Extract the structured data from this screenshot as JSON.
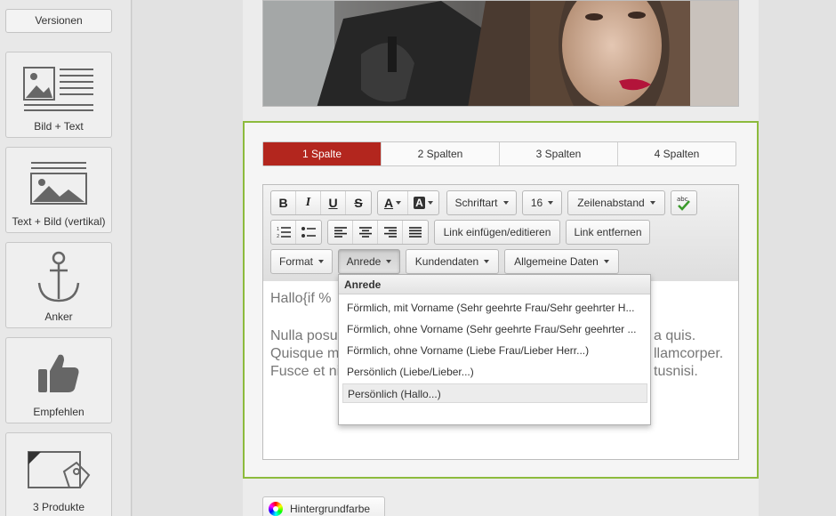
{
  "sidebar": {
    "versions_label": "Versionen",
    "tiles": [
      {
        "label": "Bild + Text",
        "icon": "image-text-icon"
      },
      {
        "label": "Text + Bild (vertikal)",
        "icon": "text-image-vertical-icon"
      },
      {
        "label": "Anker",
        "icon": "anchor-icon"
      },
      {
        "label": "Empfehlen",
        "icon": "thumbs-up-icon"
      },
      {
        "label": "3 Produkte",
        "icon": "products-tag-icon"
      }
    ]
  },
  "tabs": [
    {
      "label": "1 Spalte",
      "active": true
    },
    {
      "label": "2 Spalten",
      "active": false
    },
    {
      "label": "3 Spalten",
      "active": false
    },
    {
      "label": "4 Spalten",
      "active": false
    }
  ],
  "toolbar": {
    "font_label": "Schriftart",
    "size_label": "16",
    "line_height_label": "Zeilenabstand",
    "insert_link_label": "Link einfügen/editieren",
    "remove_link_label": "Link entfernen",
    "format_label": "Format",
    "salutation_label": "Anrede",
    "customer_data_label": "Kundendaten",
    "general_data_label": "Allgemeine Daten"
  },
  "editor": {
    "line1": "Hallo{if %",
    "line2": "Nulla posuc",
    "line3": "Quisque m",
    "line4": "Fusce et ni",
    "line2_tail": "a quis.",
    "line3_tail": "llamcorper.",
    "line4_tail": "tusnisi."
  },
  "dropdown": {
    "header": "Anrede",
    "items": [
      "Förmlich, mit Vorname (Sehr geehrte Frau/Sehr geehrter H...",
      "Förmlich, ohne Vorname (Sehr geehrte Frau/Sehr geehrter ...",
      "Förmlich, ohne Vorname (Liebe Frau/Lieber Herr...)",
      "Persönlich (Liebe/Lieber...)",
      "Persönlich (Hallo...)"
    ],
    "hovered_index": 4
  },
  "background_button_label": "Hintergrundfarbe",
  "colors": {
    "active_tab": "#b3261e",
    "block_border": "#8dbb3d",
    "spellcheck_mark": "#3a9a2a"
  }
}
